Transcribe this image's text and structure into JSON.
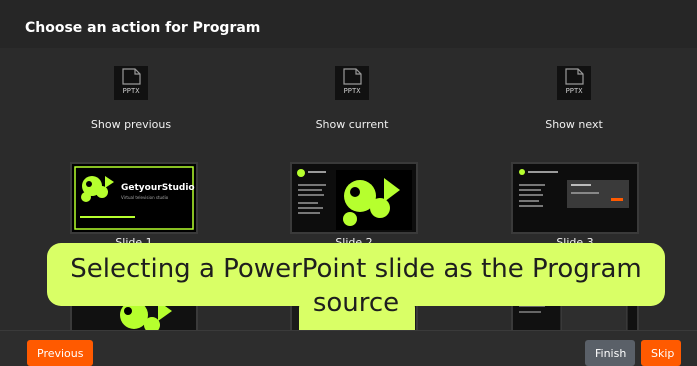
{
  "dialog": {
    "title": "Choose an action for Program"
  },
  "files": [
    {
      "label": "Show previous",
      "icon": "pptx-file-icon",
      "ext": "PPTX"
    },
    {
      "label": "Show current",
      "icon": "pptx-file-icon",
      "ext": "PPTX"
    },
    {
      "label": "Show next",
      "icon": "pptx-file-icon",
      "ext": "PPTX"
    }
  ],
  "slides": [
    {
      "label": "Slide 1",
      "brand": "GetyourStudio",
      "caption": "Virtual television studio"
    },
    {
      "label": "Slide 2"
    },
    {
      "label": "Slide 3"
    }
  ],
  "footer": {
    "previous": "Previous",
    "finish": "Finish",
    "skip": "Skip"
  },
  "overlay": {
    "caption": "Selecting a PowerPoint slide as the Program source"
  },
  "colors": {
    "accent": "#ff5a00",
    "highlight": "#d9ff66",
    "brand_green": "#b6ff2e",
    "finish_bg": "#5a6068"
  }
}
